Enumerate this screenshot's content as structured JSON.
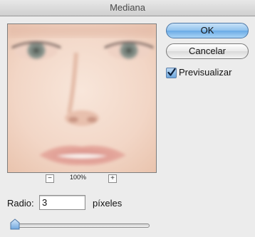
{
  "window": {
    "title": "Mediana"
  },
  "preview": {
    "image_description_icon": "face-photo",
    "zoom_out_icon": "minus-icon",
    "zoom_in_icon": "plus-icon",
    "zoom_level": "100%",
    "zoom_out_symbol": "−",
    "zoom_in_symbol": "+"
  },
  "buttons": {
    "ok_label": "OK",
    "cancel_label": "Cancelar"
  },
  "preview_option": {
    "label": "Previsualizar",
    "checked": true
  },
  "radius": {
    "label": "Radio:",
    "value": "3",
    "unit": "píxeles"
  },
  "slider": {
    "value": 3
  },
  "colors": {
    "ok_button": "#8fc2ee",
    "checkbox": "#6da6dc",
    "background": "#ececec"
  }
}
